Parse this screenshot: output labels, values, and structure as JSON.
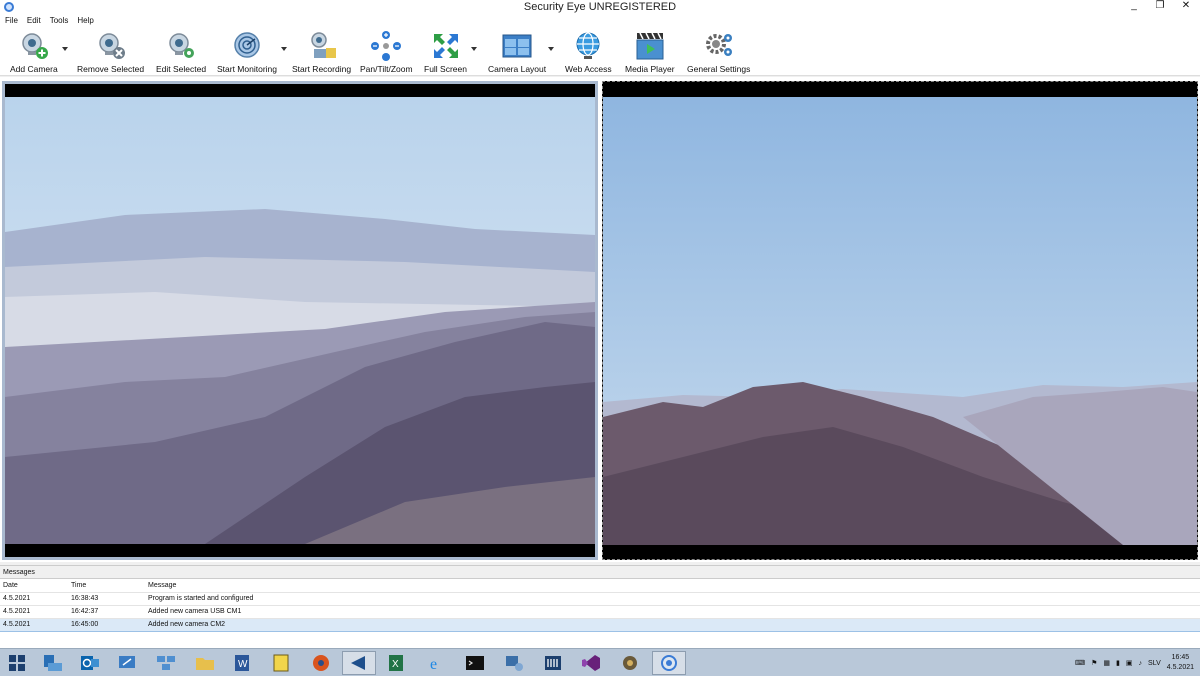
{
  "window": {
    "title": "Security Eye UNREGISTERED",
    "minimize": "_",
    "restore": "❐",
    "close": "✕"
  },
  "menu": [
    "File",
    "Edit",
    "Tools",
    "Help"
  ],
  "toolbar": {
    "add_camera": "Add Camera",
    "remove_selected": "Remove Selected",
    "edit_selected": "Edit Selected",
    "start_monitoring": "Start Monitoring",
    "start_recording": "Start Recording",
    "pan_tilt_zoom": "Pan/Tilt/Zoom",
    "full_screen": "Full Screen",
    "camera_layout": "Camera Layout",
    "web_access": "Web Access",
    "media_player": "Media Player",
    "general_settings": "General Settings"
  },
  "messages": {
    "title": "Messages",
    "columns": [
      "Date",
      "Time",
      "Message"
    ],
    "rows": [
      {
        "date": "4.5.2021",
        "time": "16:38:43",
        "message": "Program is started and configured"
      },
      {
        "date": "4.5.2021",
        "time": "16:42:37",
        "message": "Added new camera USB CM1"
      },
      {
        "date": "4.5.2021",
        "time": "16:45:00",
        "message": "Added new camera CM2"
      }
    ]
  },
  "taskbar": {
    "apps": [
      "start-icon",
      "explorer-icon",
      "outlook-icon",
      "remote-icon",
      "network-icon",
      "folder-icon",
      "word-icon",
      "notes-icon",
      "media-icon",
      "vs-code-icon",
      "excel-icon",
      "ie-icon",
      "cmd-icon",
      "network-manager-icon",
      "calculator-icon",
      "visual-studio-icon",
      "settings-icon",
      "security-eye-icon"
    ],
    "language": "SLV",
    "time": "16:45",
    "date": "4.5.2021"
  }
}
